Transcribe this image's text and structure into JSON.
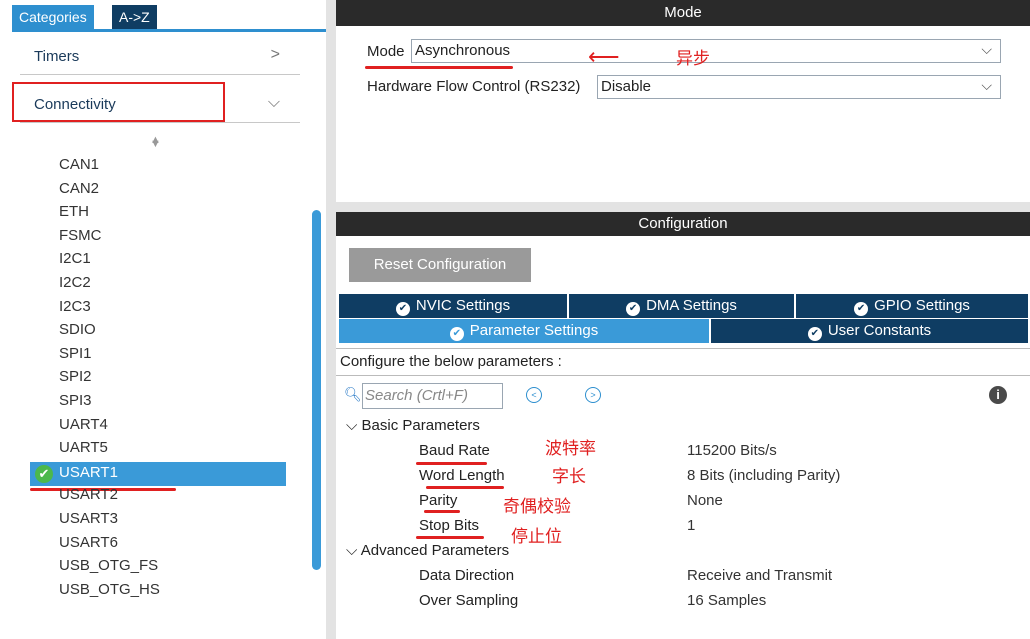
{
  "left_panel": {
    "tabs": [
      "Categories",
      "A->Z"
    ],
    "categories": [
      {
        "label": "Timers",
        "chevron": ">"
      },
      {
        "label": "Connectivity",
        "chevron": "⌵"
      }
    ],
    "peripherals": [
      "CAN1",
      "CAN2",
      "ETH",
      "FSMC",
      "I2C1",
      "I2C2",
      "I2C3",
      "SDIO",
      "SPI1",
      "SPI2",
      "SPI3",
      "UART4",
      "UART5",
      "USART1",
      "USART2",
      "USART3",
      "USART6",
      "USB_OTG_FS",
      "USB_OTG_HS"
    ],
    "selected": "USART1"
  },
  "mode": {
    "header": "Mode",
    "mode_label": "Mode",
    "mode_value": "Asynchronous",
    "flow_label": "Hardware Flow Control (RS232)",
    "flow_value": "Disable",
    "annotation": "异步"
  },
  "configuration": {
    "header": "Configuration",
    "reset_button": "Reset Configuration",
    "tabs_row1": [
      "NVIC Settings",
      "DMA Settings",
      "GPIO Settings"
    ],
    "tabs_row2": [
      "Parameter Settings",
      "User Constants"
    ],
    "active_tab": "Parameter Settings",
    "description": "Configure the below parameters :",
    "search_placeholder": "Search (Crtl+F)",
    "groups": [
      {
        "title": "Basic Parameters",
        "params": [
          {
            "name": "Baud Rate",
            "value": "115200 Bits/s",
            "note": "波特率"
          },
          {
            "name": "Word Length",
            "value": "8 Bits (including Parity)",
            "note": "字长"
          },
          {
            "name": "Parity",
            "value": "None",
            "note": "奇偶校验"
          },
          {
            "name": "Stop Bits",
            "value": "1",
            "note": "停止位"
          }
        ]
      },
      {
        "title": "Advanced Parameters",
        "params": [
          {
            "name": "Data Direction",
            "value": "Receive and Transmit"
          },
          {
            "name": "Over Sampling",
            "value": "16 Samples"
          }
        ]
      }
    ]
  },
  "colors": {
    "accent": "#3a9ad8",
    "dark_tab": "#0f3d63",
    "annotation_red": "#e02020",
    "check_green": "#4cb84c"
  }
}
